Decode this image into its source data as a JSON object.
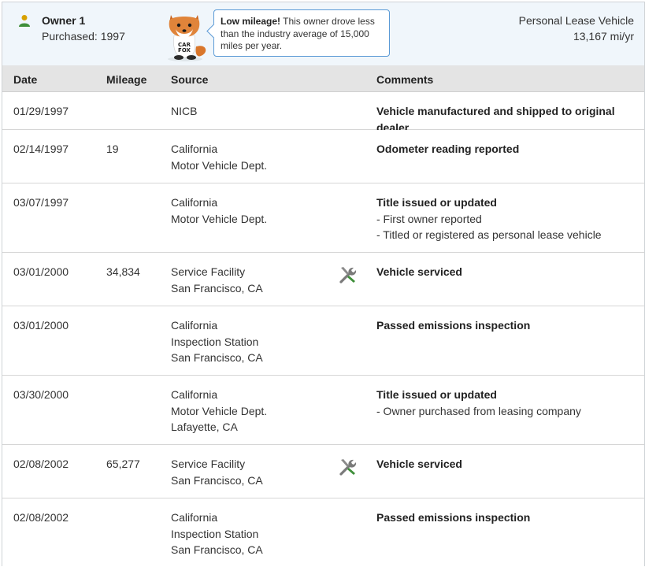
{
  "owner": {
    "title": "Owner 1",
    "purchased": "Purchased: 1997",
    "vehicle_type": "Personal Lease Vehicle",
    "mileage_rate": "13,167 mi/yr",
    "tip_bold": "Low mileage!",
    "tip_text": " This owner drove less than the industry average of 15,000 miles per year.",
    "mascot_sign": "CAR FOX"
  },
  "table": {
    "headers": {
      "date": "Date",
      "mileage": "Mileage",
      "source": "Source",
      "comments": "Comments"
    },
    "rows": [
      {
        "date": "01/29/1997",
        "mileage": "",
        "source": [
          "NICB"
        ],
        "icon": "",
        "headline": "Vehicle manufactured and shipped to original dealer",
        "details": []
      },
      {
        "date": "02/14/1997",
        "mileage": "19",
        "source": [
          "California",
          "Motor Vehicle Dept."
        ],
        "icon": "",
        "headline": "Odometer reading reported",
        "details": []
      },
      {
        "date": "03/07/1997",
        "mileage": "",
        "source": [
          "California",
          "Motor Vehicle Dept."
        ],
        "icon": "",
        "headline": "Title issued or updated",
        "details": [
          "- First owner reported",
          "- Titled or registered as personal lease vehicle"
        ]
      },
      {
        "date": "03/01/2000",
        "mileage": "34,834",
        "source": [
          "Service Facility",
          "San Francisco, CA"
        ],
        "icon": "wrench-screwdriver-icon",
        "headline": "Vehicle serviced",
        "details": []
      },
      {
        "date": "03/01/2000",
        "mileage": "",
        "source": [
          "California",
          "Inspection Station",
          "San Francisco, CA"
        ],
        "icon": "",
        "headline": "Passed emissions inspection",
        "details": []
      },
      {
        "date": "03/30/2000",
        "mileage": "",
        "source": [
          "California",
          "Motor Vehicle Dept.",
          "Lafayette, CA"
        ],
        "icon": "",
        "headline": "Title issued or updated",
        "details": [
          "- Owner purchased from leasing company"
        ]
      },
      {
        "date": "02/08/2002",
        "mileage": "65,277",
        "source": [
          "Service Facility",
          "San Francisco, CA"
        ],
        "icon": "wrench-screwdriver-icon",
        "headline": "Vehicle serviced",
        "details": []
      },
      {
        "date": "02/08/2002",
        "mileage": "",
        "source": [
          "California",
          "Inspection Station",
          "San Francisco, CA"
        ],
        "icon": "",
        "headline": "Passed emissions inspection",
        "details": []
      }
    ]
  },
  "colors": {
    "header_bg": "#f0f6fb",
    "thead_bg": "#e4e4e4",
    "tip_border": "#5b9ad6",
    "icon_green": "#3f8f3a"
  }
}
